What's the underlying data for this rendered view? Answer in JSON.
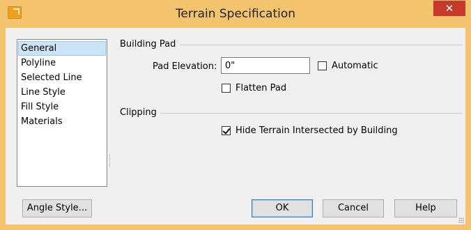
{
  "window": {
    "title": "Terrain Specification",
    "close_glyph": "✕",
    "app_icon": "app-icon"
  },
  "sidebar": {
    "items": [
      {
        "label": "General",
        "selected": true
      },
      {
        "label": "Polyline",
        "selected": false
      },
      {
        "label": "Selected Line",
        "selected": false
      },
      {
        "label": "Line Style",
        "selected": false
      },
      {
        "label": "Fill Style",
        "selected": false
      },
      {
        "label": "Materials",
        "selected": false
      }
    ],
    "angle_style_button": "Angle Style..."
  },
  "building_pad": {
    "group_label": "Building Pad",
    "pad_elevation_label": "Pad Elevation:",
    "pad_elevation_value": "0\"",
    "automatic_label": "Automatic",
    "automatic_checked": false,
    "flatten_pad_label": "Flatten Pad",
    "flatten_pad_checked": false
  },
  "clipping": {
    "group_label": "Clipping",
    "hide_terrain_label": "Hide Terrain Intersected by Building",
    "hide_terrain_checked": true
  },
  "buttons": {
    "ok": "OK",
    "cancel": "Cancel",
    "help": "Help"
  },
  "colors": {
    "titlebar": "#f4c36d",
    "close_button": "#c7392b",
    "selection": "#cce4f7"
  }
}
